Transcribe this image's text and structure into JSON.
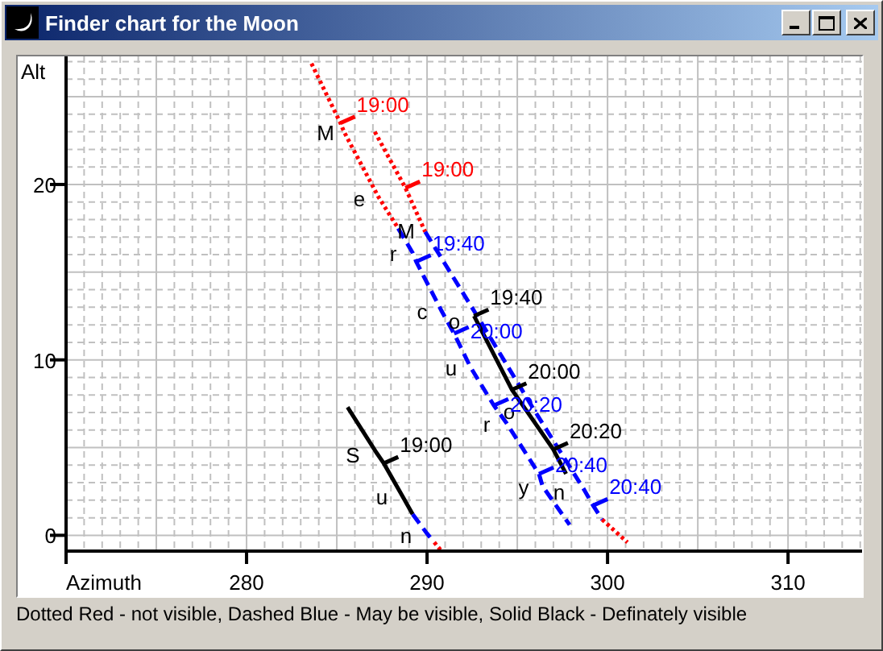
{
  "window": {
    "title": "Finder chart for the Moon"
  },
  "chart": {
    "chart_data": {
      "type": "line",
      "xlabel": "Azimuth",
      "ylabel": "Alt",
      "xlim": [
        270,
        314.1
      ],
      "ylim": [
        -0.9,
        27.3
      ],
      "xticks": [
        280,
        290,
        300,
        310
      ],
      "yticks": [
        0,
        10,
        20
      ],
      "grid": true,
      "series": [
        {
          "line_style": "dotted",
          "color": "#ff0000",
          "x": [
            283.6,
            285.2,
            285.4,
            287.3,
            288.4
          ],
          "values": [
            26.9,
            23.5,
            23.0,
            19.3,
            17.5
          ]
        },
        {
          "line_style": "dashed",
          "color": "#0000ff",
          "x": [
            288.4,
            289.2,
            289.4,
            290.8,
            291.5,
            292.4,
            293.7,
            294.4,
            296.2,
            296.4,
            297.9
          ],
          "values": [
            17.5,
            16.1,
            15.6,
            12.8,
            11.5,
            9.6,
            7.4,
            6.4,
            3.5,
            2.8,
            0.6
          ]
        },
        {
          "line_style": "dotted",
          "color": "#ff0000",
          "x": [
            287.1,
            288.8,
            289.9
          ],
          "values": [
            23.0,
            19.8,
            17.3
          ]
        },
        {
          "line_style": "dashed",
          "color": "#0000ff",
          "x": [
            289.9,
            292.9,
            295.9,
            298.7,
            299.2,
            299.7
          ],
          "values": [
            17.3,
            12.3,
            7.2,
            2.6,
            1.7,
            0.9
          ]
        },
        {
          "line_style": "dotted",
          "color": "#ff0000",
          "x": [
            299.7,
            301.1
          ],
          "values": [
            0.9,
            -0.4
          ]
        },
        {
          "line_style": "solid",
          "color": "#000000",
          "x": [
            292.6,
            294.7,
            297.0,
            297.7
          ],
          "values": [
            12.5,
            8.3,
            4.9,
            3.5
          ]
        },
        {
          "line_style": "solid",
          "color": "#000000",
          "x": [
            285.6,
            287.2,
            287.6,
            288.6,
            289.2
          ],
          "values": [
            7.3,
            4.7,
            4.1,
            2.3,
            1.2
          ]
        },
        {
          "line_style": "dashed",
          "color": "#0000ff",
          "x": [
            289.2,
            290.0,
            290.4
          ],
          "values": [
            1.2,
            0.1,
            -0.4
          ]
        },
        {
          "line_style": "dotted",
          "color": "#ff0000",
          "x": [
            290.4,
            290.8
          ],
          "values": [
            -0.4,
            -0.9
          ]
        }
      ],
      "annotations": [
        {
          "text": "19:00",
          "x": 285.2,
          "y": 23.5
        },
        {
          "text": "19:00",
          "x": 288.8,
          "y": 19.8
        },
        {
          "text": "19:40",
          "x": 289.4,
          "y": 15.6
        },
        {
          "text": "19:40",
          "x": 292.6,
          "y": 12.5
        },
        {
          "text": "20:00",
          "x": 291.5,
          "y": 11.5
        },
        {
          "text": "20:00",
          "x": 294.7,
          "y": 8.3
        },
        {
          "text": "20:20",
          "x": 293.7,
          "y": 7.4
        },
        {
          "text": "20:20",
          "x": 297.0,
          "y": 4.9
        },
        {
          "text": "20:40",
          "x": 296.2,
          "y": 3.5
        },
        {
          "text": "20:40",
          "x": 299.2,
          "y": 1.7
        },
        {
          "text": "19:00",
          "x": 287.6,
          "y": 4.1
        }
      ]
    },
    "track_letters": [
      [
        "M",
        "e",
        "r",
        "c",
        "u",
        "r",
        "y"
      ],
      [
        "M",
        "o",
        "o",
        "n"
      ],
      [
        "S",
        "u",
        "n"
      ]
    ]
  },
  "legend": "Dotted Red - not visible, Dashed Blue - May be visible, Solid Black - Definately visible"
}
